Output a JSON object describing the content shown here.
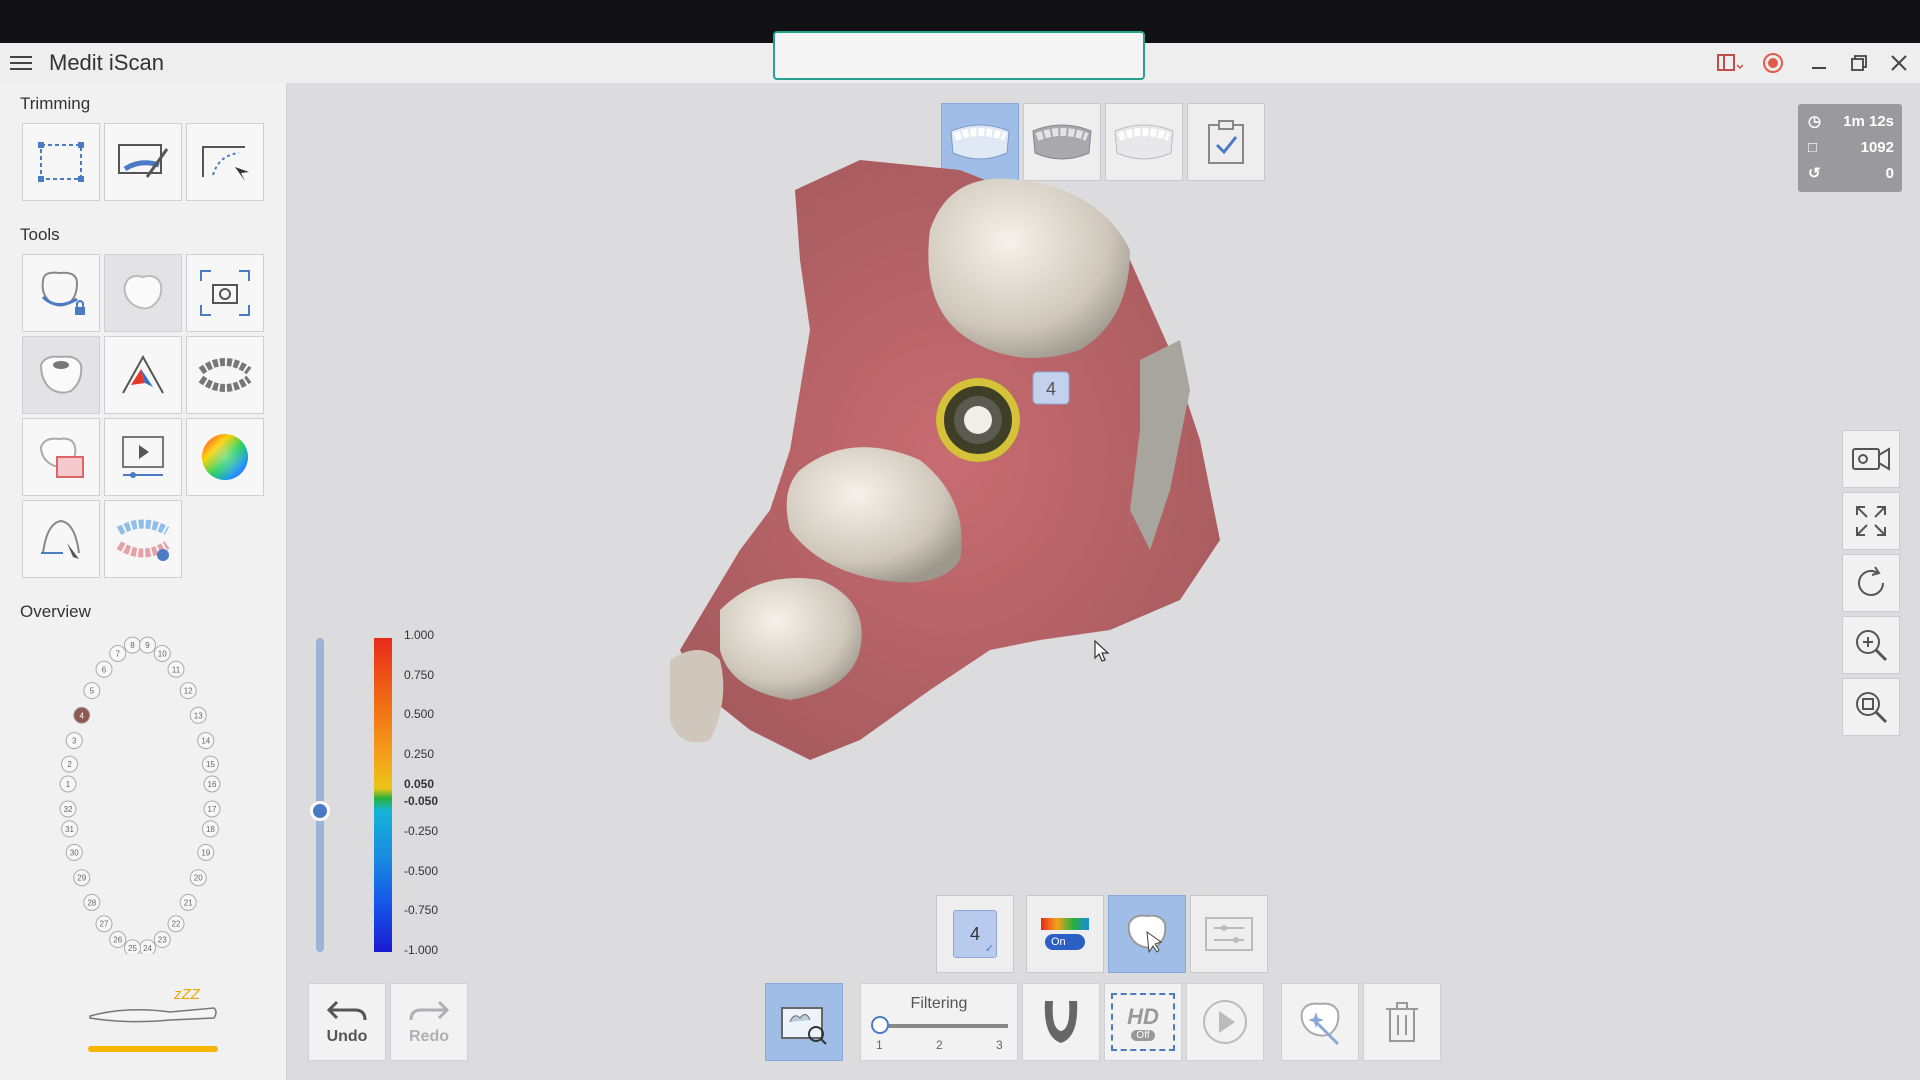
{
  "app": {
    "title": "Medit iScan"
  },
  "notification": {
    "text": ""
  },
  "sidebar": {
    "trimming_title": "Trimming",
    "tools_title": "Tools",
    "overview_title": "Overview",
    "trimming_tools": [
      "select-area-icon",
      "brush-trim-icon",
      "lasso-trim-icon"
    ],
    "tools": [
      "lock-tooth-icon",
      "tooth-icon",
      "capture-icon",
      "abutment-icon",
      "margin-line-icon",
      "occlusion-icon",
      "bite-icon",
      "play-video-icon",
      "color-wheel-icon",
      "prep-icon",
      "arch-icon"
    ],
    "tooth_numbers_upper": [
      "1",
      "2",
      "3",
      "4",
      "5",
      "6",
      "7",
      "8",
      "9",
      "10",
      "11",
      "12",
      "13",
      "14",
      "15",
      "16"
    ],
    "tooth_numbers_lower": [
      "17",
      "18",
      "19",
      "20",
      "21",
      "22",
      "23",
      "24",
      "25",
      "26",
      "27",
      "28",
      "29",
      "30",
      "31",
      "32"
    ],
    "selected_tooth": "4",
    "scanner_status": "zZZ"
  },
  "stats": {
    "time": "1m 12s",
    "frames": "1092",
    "count": "0"
  },
  "scale": {
    "labels": [
      "1.000",
      "0.750",
      "0.500",
      "0.250",
      "0.050",
      "-0.050",
      "-0.250",
      "-0.500",
      "-0.750",
      "-1.000"
    ],
    "slider_value": 0.45
  },
  "model": {
    "tooth_label": "4"
  },
  "stage_tabs": [
    "upper-jaw-icon",
    "lower-jaw-icon",
    "occlusion-icon",
    "checklist-icon"
  ],
  "mid_toolbar": {
    "tooth_badge": "4",
    "color_toggle": "On"
  },
  "bottom_toolbar": {
    "undo": "Undo",
    "redo": "Redo",
    "filtering": "Filtering",
    "filter_ticks": [
      "1",
      "2",
      "3"
    ],
    "filter_value": 1,
    "hd_label": "HD",
    "hd_state": "Off"
  },
  "colors": {
    "accent": "#27a08c",
    "active": "#9fbde6",
    "bar": "#f7b500"
  }
}
